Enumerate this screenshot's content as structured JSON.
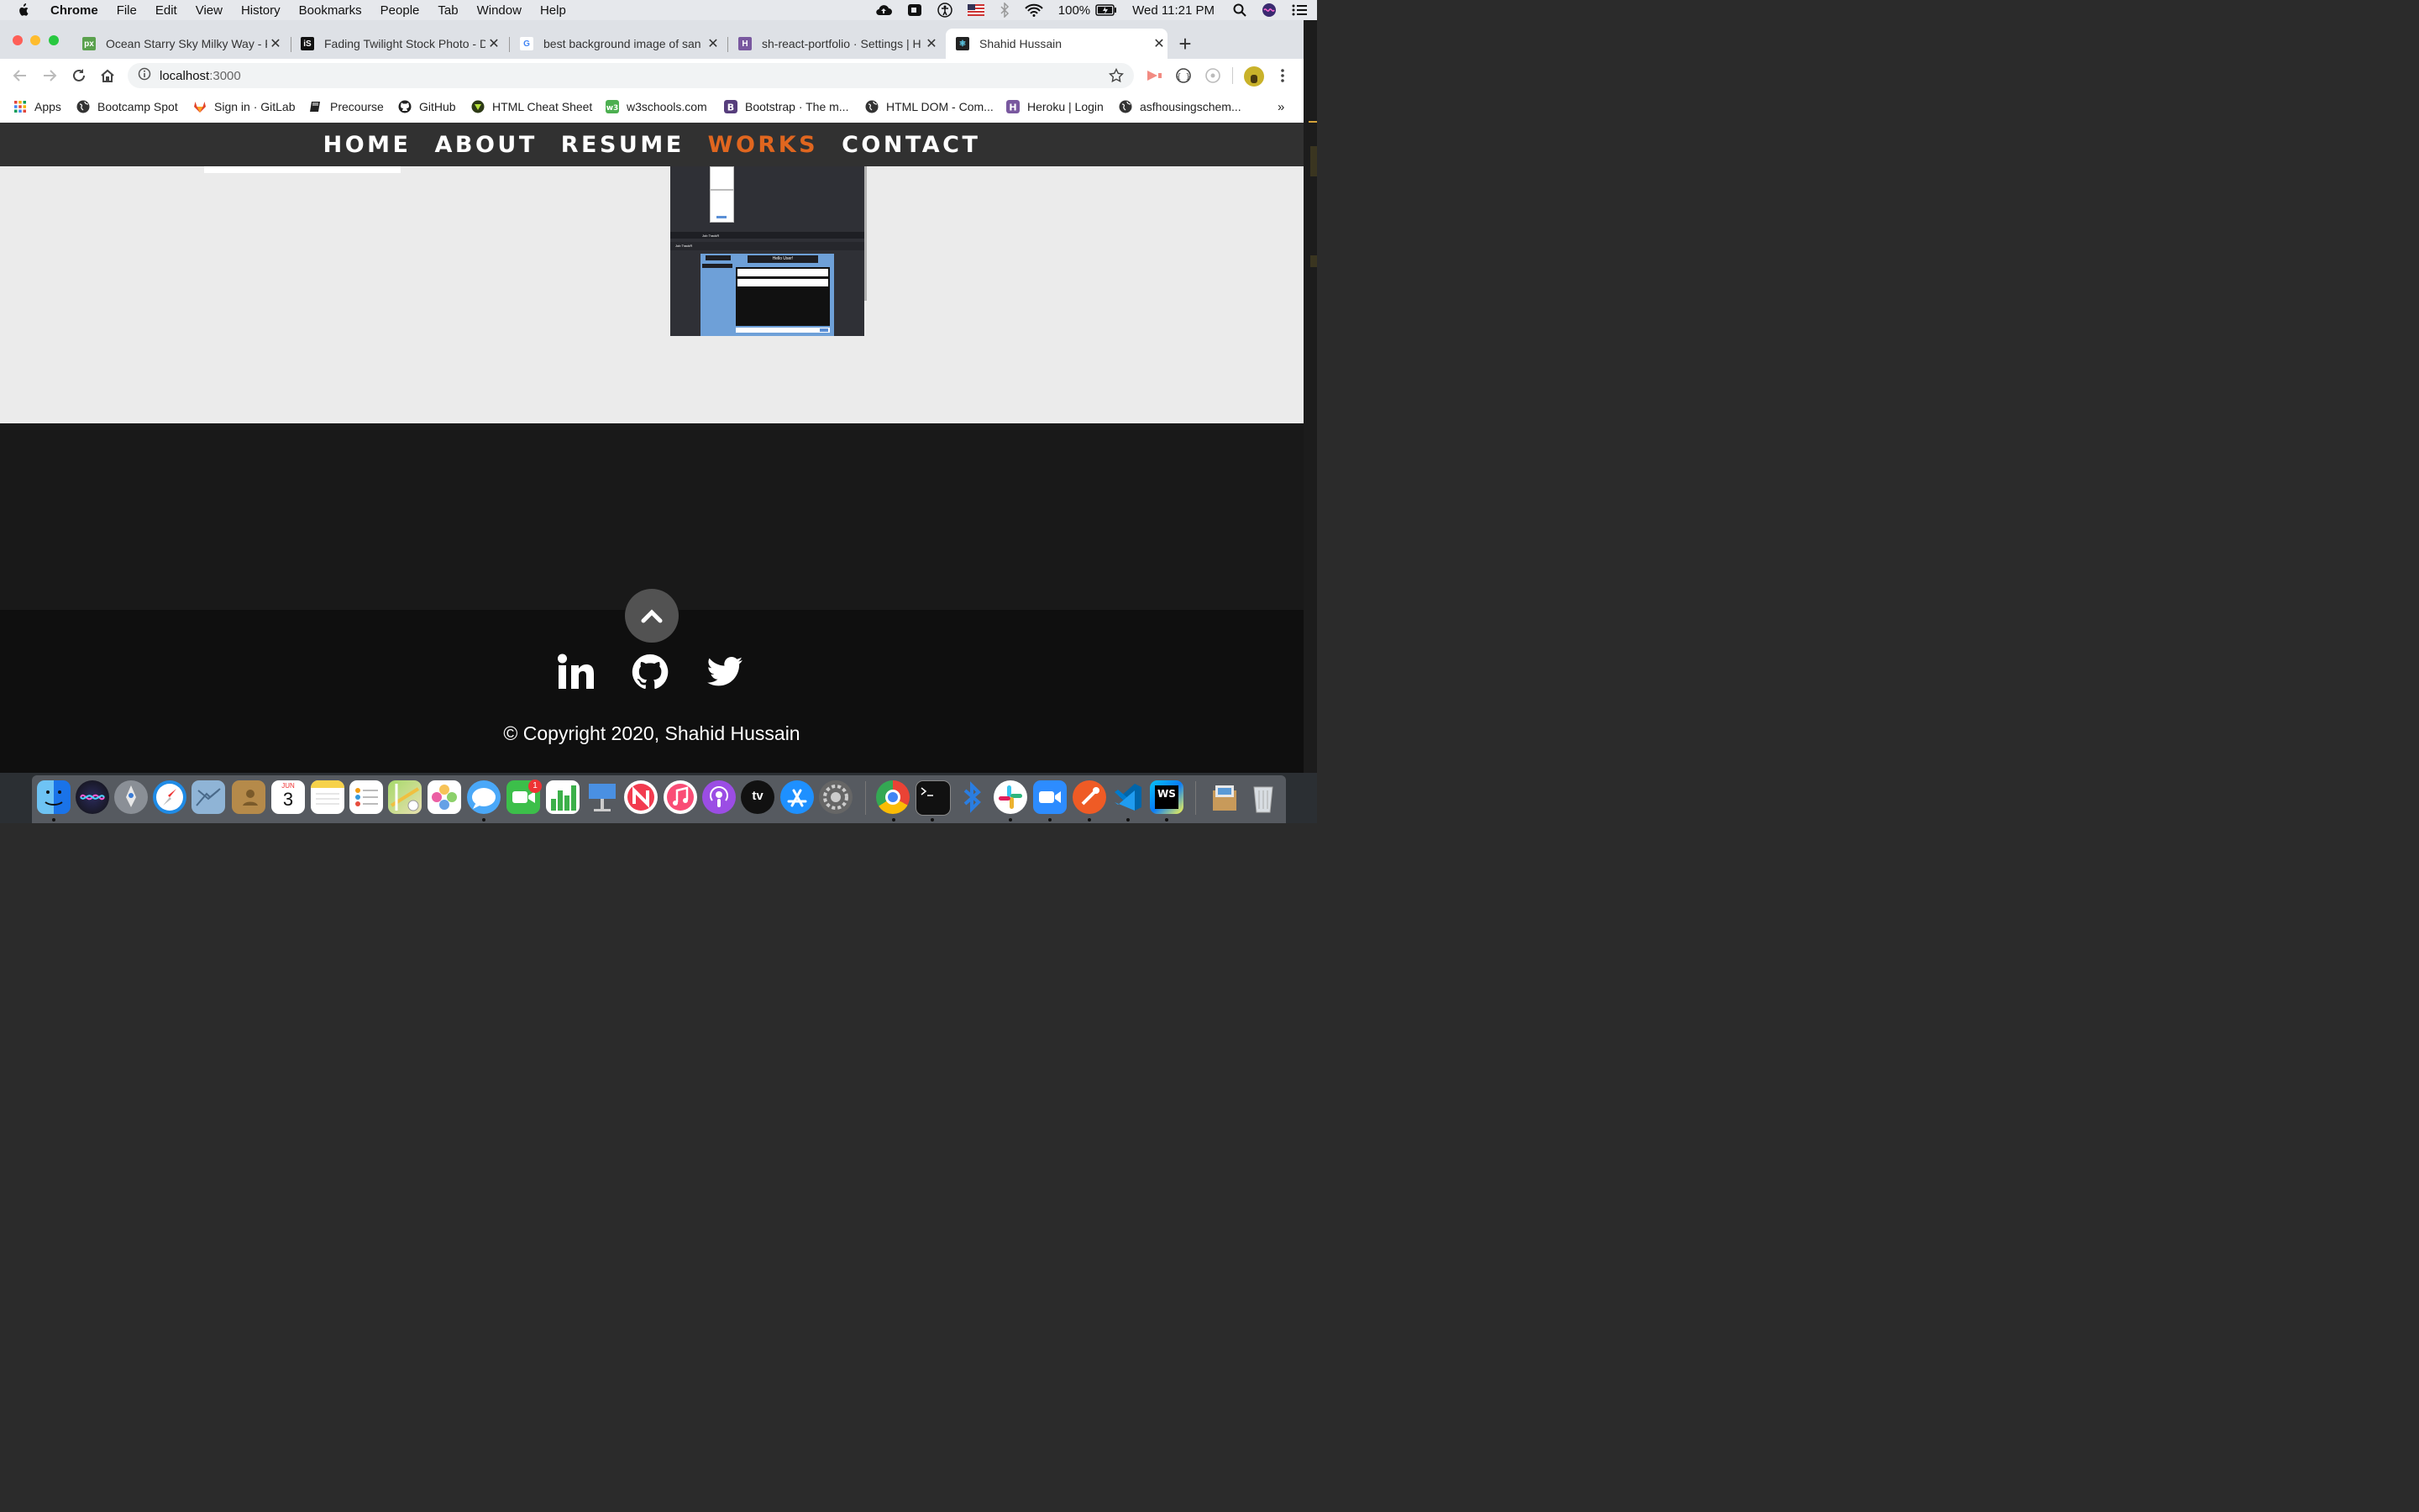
{
  "menubar": {
    "app": "Chrome",
    "items": [
      "File",
      "Edit",
      "View",
      "History",
      "Bookmarks",
      "People",
      "Tab",
      "Window",
      "Help"
    ],
    "battery": "100%",
    "clock": "Wed 11:21 PM"
  },
  "tabs": [
    {
      "title": "Ocean Starry Sky Milky Way - F",
      "favicon_color": "#5aa14d",
      "favicon_text": "px"
    },
    {
      "title": "Fading Twilight Stock Photo - D",
      "favicon_color": "#111111",
      "favicon_text": "iS"
    },
    {
      "title": "best background image of san",
      "favicon_color": "#4285f4",
      "favicon_text": "G"
    },
    {
      "title": "sh-react-portfolio · Settings | H",
      "favicon_color": "#79589f",
      "favicon_text": "H"
    },
    {
      "title": "Shahid Hussain",
      "favicon_color": "#1e8a9a",
      "favicon_text": "⚛"
    }
  ],
  "toolbar": {
    "url_host": "localhost",
    "url_port": ":3000"
  },
  "bookmarks": [
    {
      "label": "Apps",
      "icon": "apps-grid-icon",
      "color": "#e2453c"
    },
    {
      "label": "Bootcamp Spot",
      "icon": "globe-icon",
      "color": "#333333"
    },
    {
      "label": "Sign in · GitLab",
      "icon": "gitlab-icon",
      "color": "#e24329"
    },
    {
      "label": "Precourse",
      "icon": "book-icon",
      "color": "#222222"
    },
    {
      "label": "GitHub",
      "icon": "github-icon",
      "color": "#222222"
    },
    {
      "label": "HTML Cheat Sheet",
      "icon": "cheatsheet-icon",
      "color": "#2d3a16"
    },
    {
      "label": "w3schools.com",
      "icon": "w3schools-icon",
      "color": "#4caf50"
    },
    {
      "label": "Bootstrap · The m...",
      "icon": "bootstrap-icon",
      "color": "#563d7c"
    },
    {
      "label": "HTML DOM - Com...",
      "icon": "globe-icon",
      "color": "#333333"
    },
    {
      "label": "Heroku | Login",
      "icon": "heroku-icon",
      "color": "#79589f"
    },
    {
      "label": "asfhousingschem...",
      "icon": "globe-icon",
      "color": "#333333"
    }
  ],
  "bookmarks_overflow": "»",
  "site": {
    "nav": [
      {
        "label": "HOME",
        "active": false
      },
      {
        "label": "ABOUT",
        "active": false
      },
      {
        "label": "RESUME",
        "active": false
      },
      {
        "label": "WORKS",
        "active": true
      },
      {
        "label": "CONTACT",
        "active": false
      }
    ],
    "accent": "#e0661f",
    "project_preview": {
      "brand": "Job TrackR",
      "greeting": "Hello User!"
    },
    "social": [
      "linkedin-icon",
      "github-icon",
      "twitter-icon"
    ],
    "copyright": "© Copyright 2020, Shahid Hussain"
  },
  "dock": {
    "calendar_month": "JUN",
    "calendar_day": "3",
    "facetime_badge": "1",
    "appletv_label": "tv"
  }
}
